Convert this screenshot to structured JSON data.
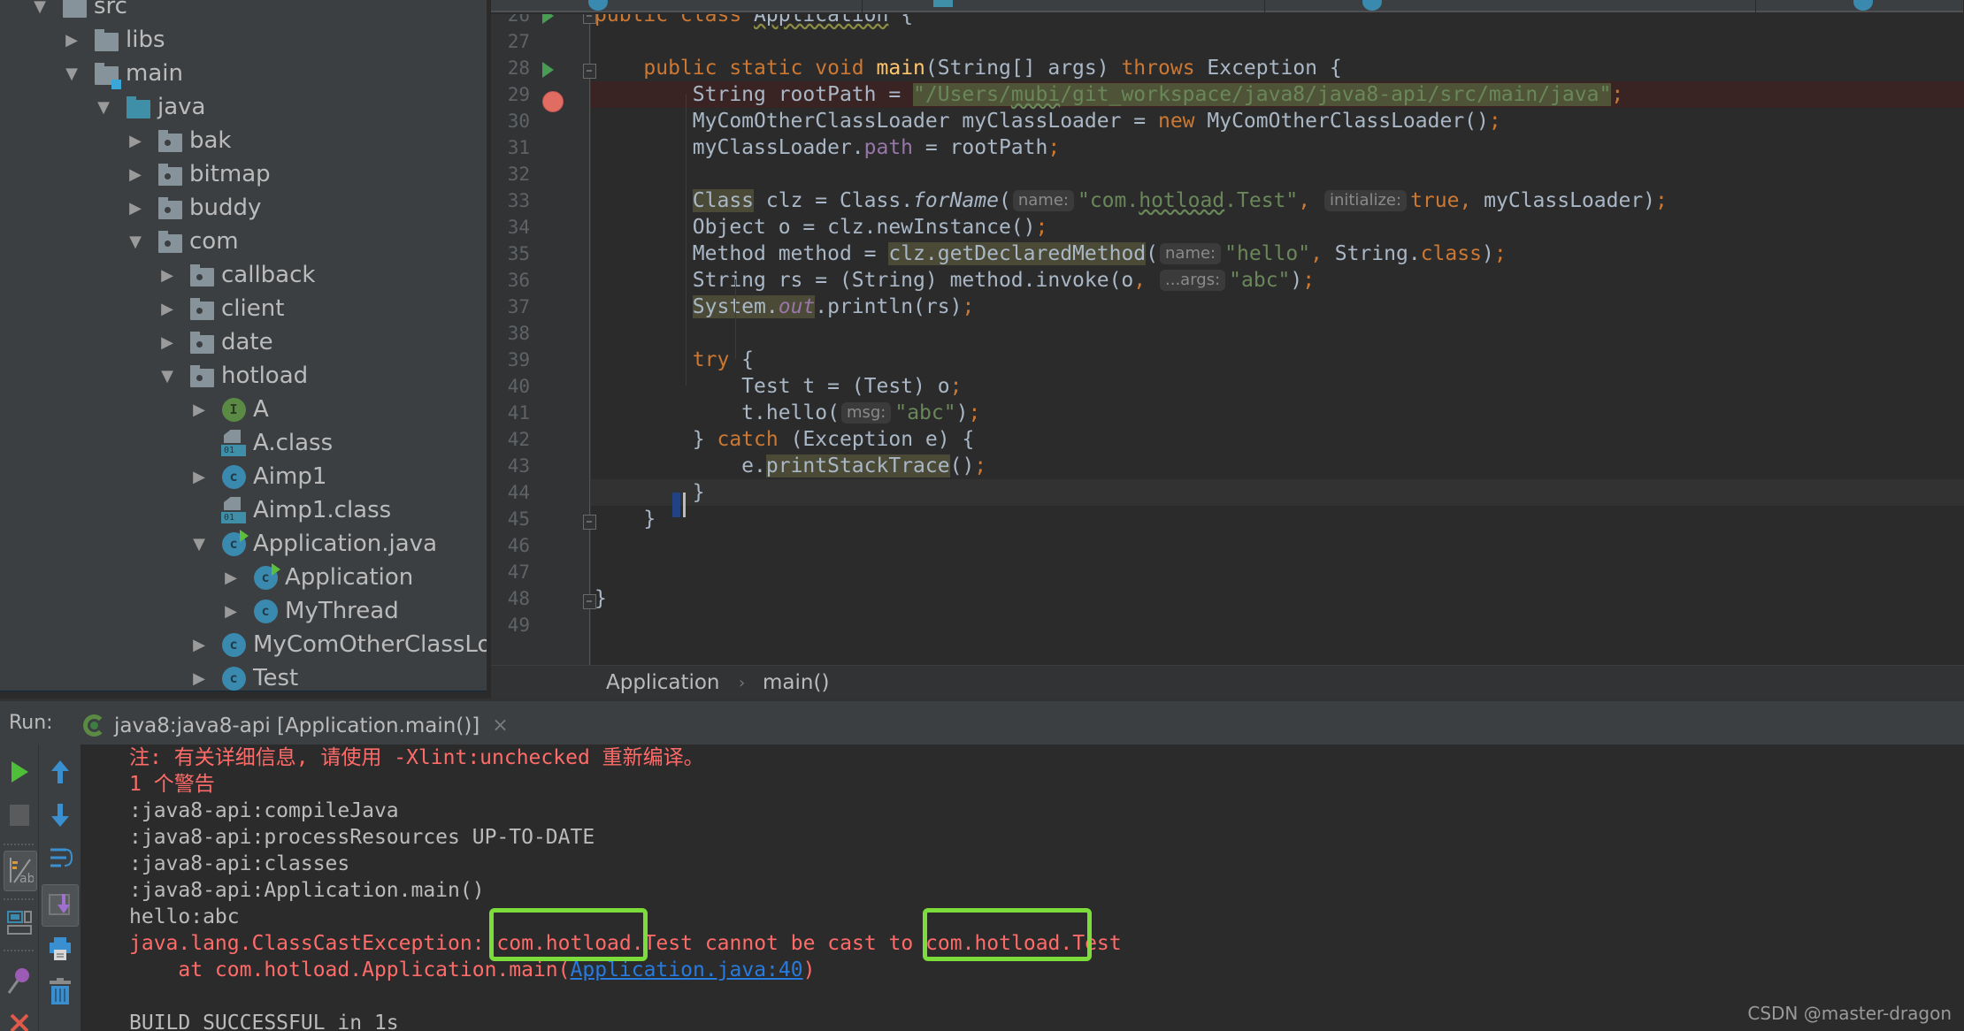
{
  "project_tree": {
    "items": [
      {
        "label": "src",
        "depth": 0,
        "expanded": true,
        "icon": "folder"
      },
      {
        "label": "libs",
        "depth": 1,
        "expanded": false,
        "icon": "folder"
      },
      {
        "label": "main",
        "depth": 1,
        "expanded": true,
        "icon": "module-folder"
      },
      {
        "label": "java",
        "depth": 2,
        "expanded": true,
        "icon": "source-folder"
      },
      {
        "label": "bak",
        "depth": 3,
        "expanded": false,
        "icon": "package"
      },
      {
        "label": "bitmap",
        "depth": 3,
        "expanded": false,
        "icon": "package"
      },
      {
        "label": "buddy",
        "depth": 3,
        "expanded": false,
        "icon": "package"
      },
      {
        "label": "com",
        "depth": 3,
        "expanded": true,
        "icon": "package"
      },
      {
        "label": "callback",
        "depth": 4,
        "expanded": false,
        "icon": "package"
      },
      {
        "label": "client",
        "depth": 4,
        "expanded": false,
        "icon": "package"
      },
      {
        "label": "date",
        "depth": 4,
        "expanded": false,
        "icon": "package"
      },
      {
        "label": "hotload",
        "depth": 4,
        "expanded": true,
        "icon": "package"
      },
      {
        "label": "A",
        "depth": 5,
        "expanded": false,
        "icon": "interface"
      },
      {
        "label": "A.class",
        "depth": 5,
        "expanded": null,
        "icon": "class-file"
      },
      {
        "label": "Aimp1",
        "depth": 5,
        "expanded": false,
        "icon": "class"
      },
      {
        "label": "Aimp1.class",
        "depth": 5,
        "expanded": null,
        "icon": "class-file"
      },
      {
        "label": "Application.java",
        "depth": 5,
        "expanded": true,
        "icon": "runnable-class"
      },
      {
        "label": "Application",
        "depth": 6,
        "expanded": false,
        "icon": "runnable-class"
      },
      {
        "label": "MyThread",
        "depth": 6,
        "expanded": false,
        "icon": "class"
      },
      {
        "label": "MyComOtherClassLoader",
        "depth": 5,
        "expanded": false,
        "icon": "class"
      },
      {
        "label": "Test",
        "depth": 5,
        "expanded": false,
        "icon": "class"
      }
    ]
  },
  "editor": {
    "lines": [
      {
        "n": "26",
        "html": "<span class='kw'>public class</span> <span class='warn'>Application</span> {"
      },
      {
        "n": "27",
        "html": ""
      },
      {
        "n": "28",
        "html": "    <span class='kw'>public static void</span> <span class='fn'>main</span>(String[] args) <span class='kw'>throws</span> Exception {"
      },
      {
        "n": "29",
        "html": "        String rootPath = <span class='str strhl'>\"/Users/<span class='warn-g'>mubi</span>/git_workspace/java8/java8-api/src/main/java\"</span><span class='kw'>;</span>"
      },
      {
        "n": "30",
        "html": "        MyComOtherClassLoader myClassLoader = <span class='kw'>new</span> MyComOtherClassLoader()<span class='kw'>;</span>"
      },
      {
        "n": "31",
        "html": "        myClassLoader.<span class='fld'>path</span> = rootPath<span class='kw'>;</span>"
      },
      {
        "n": "32",
        "html": ""
      },
      {
        "n": "33",
        "html": "        <span class='hl'>Class</span> clz = Class.<span class='it'>forName</span>(<span class='hint'>name:</span><span class='str'>\"com.<span class='warn-g'>hotload</span>.Test\"</span><span class='kw'>,</span> <span class='hint'>initialize:</span><span class='kw'>true,</span> myClassLoader)<span class='kw'>;</span>"
      },
      {
        "n": "34",
        "html": "        Object o = clz.newInstance()<span class='kw'>;</span>"
      },
      {
        "n": "35",
        "html": "        Method method = <span class='hl'>clz.getDeclaredMethod</span>(<span class='hint'>name:</span><span class='str'>\"hello\"</span><span class='kw'>,</span> String.<span class='kw'>class</span>)<span class='kw'>;</span>"
      },
      {
        "n": "36",
        "html": "        String rs = (String) method.invoke(o<span class='kw'>,</span> <span class='hint'>...args:</span><span class='str'>\"abc\"</span>)<span class='kw'>;</span>"
      },
      {
        "n": "37",
        "html": "        <span class='hl'>System.<span class='fld it'>out</span></span>.println(rs)<span class='kw'>;</span>"
      },
      {
        "n": "38",
        "html": ""
      },
      {
        "n": "39",
        "html": "        <span class='kw'>try</span> {"
      },
      {
        "n": "40",
        "html": "            Test t = (Test) o<span class='kw'>;</span>"
      },
      {
        "n": "41",
        "html": "            t.hello(<span class='hint'>msg:</span><span class='str'>\"abc\"</span>)<span class='kw'>;</span>"
      },
      {
        "n": "42",
        "html": "        } <span class='kw'>catch</span> (Exception e) {"
      },
      {
        "n": "43",
        "html": "            e.<span class='hl'>printStackTrace</span>()<span class='kw'>;</span>"
      },
      {
        "n": "44",
        "html": "        }"
      },
      {
        "n": "45",
        "html": "    }"
      },
      {
        "n": "46",
        "html": ""
      },
      {
        "n": "47",
        "html": ""
      },
      {
        "n": "48",
        "html": "}"
      },
      {
        "n": "49",
        "html": ""
      }
    ],
    "breakpoint_line": "29",
    "current_line": "44"
  },
  "breadcrumb": {
    "items": [
      "Application",
      "main()"
    ],
    "separator": "›"
  },
  "run_panel": {
    "label": "Run:",
    "tab_title": "java8:java8-api [Application.main()]",
    "tab_close": "×",
    "console": [
      {
        "text": "注: 有关详细信息, 请使用 -Xlint:unchecked 重新编译。",
        "type": "err"
      },
      {
        "text": "1 个警告",
        "type": "err"
      },
      {
        "text": ":java8-api:compileJava",
        "type": "out"
      },
      {
        "text": ":java8-api:processResources UP-TO-DATE",
        "type": "out"
      },
      {
        "text": ":java8-api:classes",
        "type": "out"
      },
      {
        "text": ":java8-api:Application.main()",
        "type": "out"
      },
      {
        "text": "hello:abc",
        "type": "out"
      },
      {
        "text": "java.lang.ClassCastException: com.hotload.Test cannot be cast to com.hotload.Test",
        "type": "err"
      },
      {
        "text": "",
        "type": "stack"
      },
      {
        "text": "",
        "type": "out"
      },
      {
        "text": "BUILD SUCCESSFUL in 1s",
        "type": "out"
      }
    ],
    "stack_prefix": "    at com.hotload.Application.main(",
    "stack_link": "Application.java:40",
    "stack_suffix": ")",
    "highlight_boxes": [
      "com.hotload.Test",
      "com.hotload.Test"
    ],
    "highlight_color": "#7cdc3a"
  },
  "watermark": "CSDN @master-dragon"
}
